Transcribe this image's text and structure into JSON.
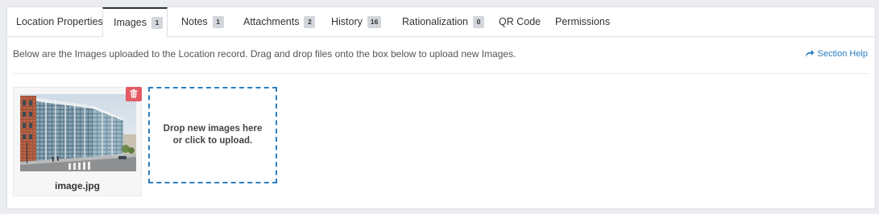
{
  "tabs": [
    {
      "label": "Location Properties",
      "count": null
    },
    {
      "label": "Images",
      "count": "1"
    },
    {
      "label": "Notes",
      "count": "1"
    },
    {
      "label": "Attachments",
      "count": "2"
    },
    {
      "label": "History",
      "count": "16"
    },
    {
      "label": "Rationalization",
      "count": "0"
    },
    {
      "label": "QR Code",
      "count": null
    },
    {
      "label": "Permissions",
      "count": null
    }
  ],
  "active_tab": "Images",
  "description": "Below are the Images uploaded to the Location record. Drag and drop files onto the box below to upload new Images.",
  "section_help": {
    "label": "Section Help",
    "icon": "share-arrow-icon"
  },
  "images": [
    {
      "filename": "image.jpg",
      "delete_icon": "trash-icon"
    }
  ],
  "dropzone": {
    "text": "Drop new images here or click to upload."
  },
  "colors": {
    "accent": "#2b7ec0",
    "delete": "#e35b63",
    "badge_bg": "#d3d6db",
    "background": "#ecedf1"
  }
}
